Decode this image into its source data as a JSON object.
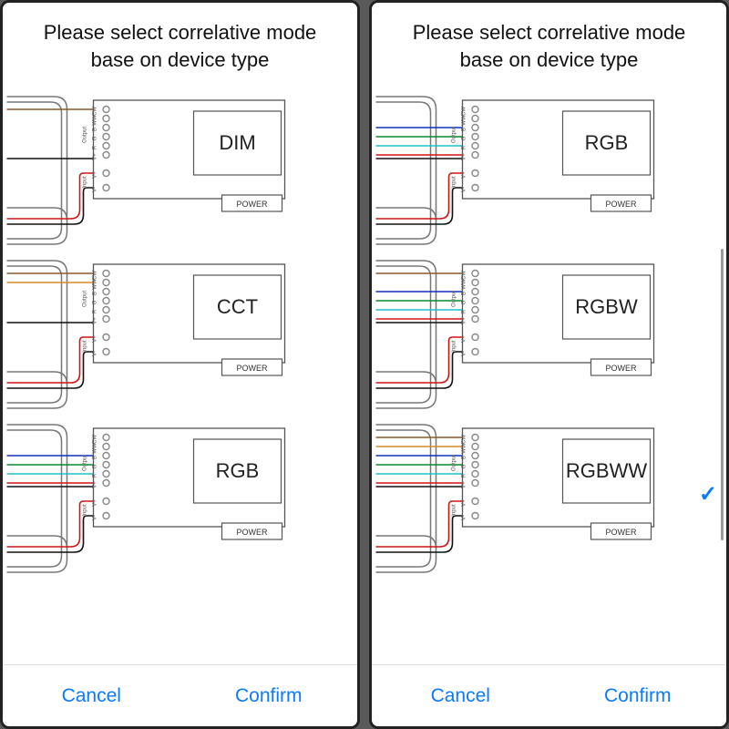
{
  "title": "Please select correlative mode base on device type",
  "buttons": {
    "cancel": "Cancel",
    "confirm": "Confirm"
  },
  "power_label": "POWER",
  "terminal_labels": [
    "CW",
    "WW",
    "B",
    "G",
    "R",
    "V+",
    "V+",
    "V-"
  ],
  "side_labels": {
    "output": "Output",
    "input": "Input"
  },
  "left_panel": {
    "options": [
      {
        "id": "dim",
        "label": "DIM",
        "wires": [
          "brown"
        ],
        "selected": false
      },
      {
        "id": "cct",
        "label": "CCT",
        "wires": [
          "brown",
          "orange"
        ],
        "selected": false
      },
      {
        "id": "rgb",
        "label": "RGB",
        "wires": [
          "blue",
          "green",
          "cyan",
          "red"
        ],
        "selected": false
      }
    ]
  },
  "right_panel": {
    "options": [
      {
        "id": "rgb",
        "label": "RGB",
        "wires": [
          "blue",
          "green",
          "cyan",
          "red"
        ],
        "selected": false
      },
      {
        "id": "rgbw",
        "label": "RGBW",
        "wires": [
          "brown",
          "blue",
          "green",
          "cyan",
          "red"
        ],
        "selected": false
      },
      {
        "id": "rgbww",
        "label": "RGBWW",
        "wires": [
          "brown",
          "orange",
          "blue",
          "green",
          "cyan",
          "red"
        ],
        "selected": true
      }
    ]
  },
  "wire_colors": {
    "brown": "#8a5a2a",
    "orange": "#d98a2a",
    "blue": "#1030c0",
    "green": "#0a8a2a",
    "cyan": "#20c0d0",
    "red": "#d01515",
    "black": "#111"
  }
}
